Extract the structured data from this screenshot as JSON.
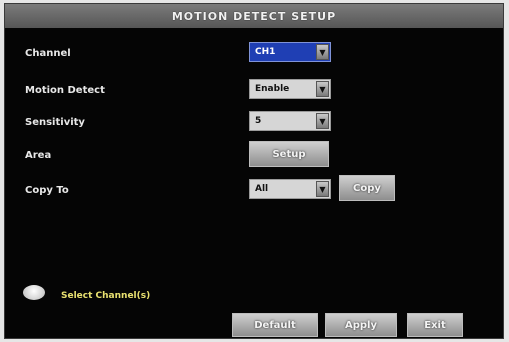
{
  "window": {
    "title": "MOTION DETECT SETUP"
  },
  "fields": {
    "channel": {
      "label": "Channel",
      "value": "CH1"
    },
    "motion_detect": {
      "label": "Motion Detect",
      "value": "Enable"
    },
    "sensitivity": {
      "label": "Sensitivity",
      "value": "5"
    },
    "area": {
      "label": "Area",
      "button": "Setup"
    },
    "copy_to": {
      "label": "Copy To",
      "value": "All",
      "button": "Copy"
    }
  },
  "hint": {
    "icon": "speech-bubble-icon",
    "text": "Select Channel(s)"
  },
  "footer": {
    "default_label": "Default",
    "apply_label": "Apply",
    "exit_label": "Exit"
  },
  "icons": {
    "dropdown": "chevron-down-icon"
  },
  "colors": {
    "background": "#050505",
    "title_bar": "#6a6a6a",
    "focus": "#1f3fb4",
    "hint_text": "#e8e070"
  }
}
